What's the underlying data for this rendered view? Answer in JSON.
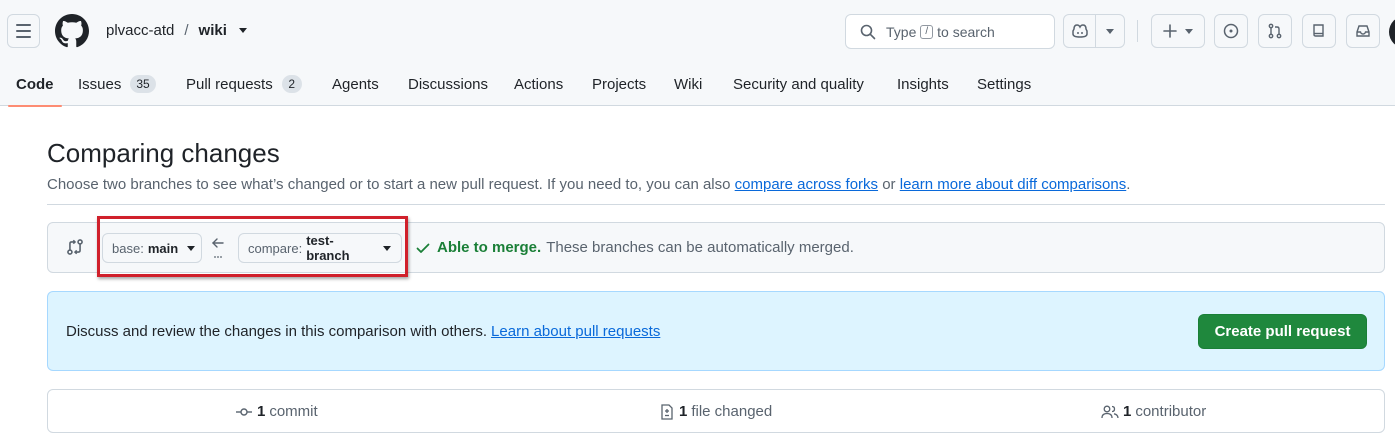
{
  "header": {
    "owner": "plvacc-atd",
    "separator": "/",
    "repo": "wiki",
    "search_prefix": "Type",
    "search_key": "/",
    "search_suffix": "to search"
  },
  "tabs": [
    {
      "label": "Code",
      "selected": true
    },
    {
      "label": "Issues",
      "count": "35"
    },
    {
      "label": "Pull requests",
      "count": "2"
    },
    {
      "label": "Agents"
    },
    {
      "label": "Discussions"
    },
    {
      "label": "Actions"
    },
    {
      "label": "Projects"
    },
    {
      "label": "Wiki"
    },
    {
      "label": "Security and quality"
    },
    {
      "label": "Insights"
    },
    {
      "label": "Settings"
    }
  ],
  "main": {
    "title": "Comparing changes",
    "subtitle_text": "Choose two branches to see what’s changed or to start a new pull request. If you need to, you can also",
    "link_forks": "compare across forks",
    "subtitle_or": "or",
    "link_diff": "learn more about diff comparisons",
    "subtitle_end": "."
  },
  "range": {
    "base_prefix": "base:",
    "base_value": "main",
    "compare_prefix": "compare:",
    "compare_value": "test-branch",
    "merge_ok": "Able to merge.",
    "merge_text": "These branches can be automatically merged."
  },
  "blankslate": {
    "text": "Discuss and review the changes in this comparison with others.",
    "link": "Learn about pull requests",
    "button": "Create pull request"
  },
  "stats": {
    "commits_count": "1",
    "commits_label": "commit",
    "files_count": "1",
    "files_label": "file changed",
    "contributors_count": "1",
    "contributors_label": "contributor"
  },
  "colors": {
    "accent_link": "#0969da",
    "success": "#1a7f37",
    "primary_button": "#1f883d",
    "highlight": "#d0202b",
    "tab_underline": "#fd8c73"
  }
}
